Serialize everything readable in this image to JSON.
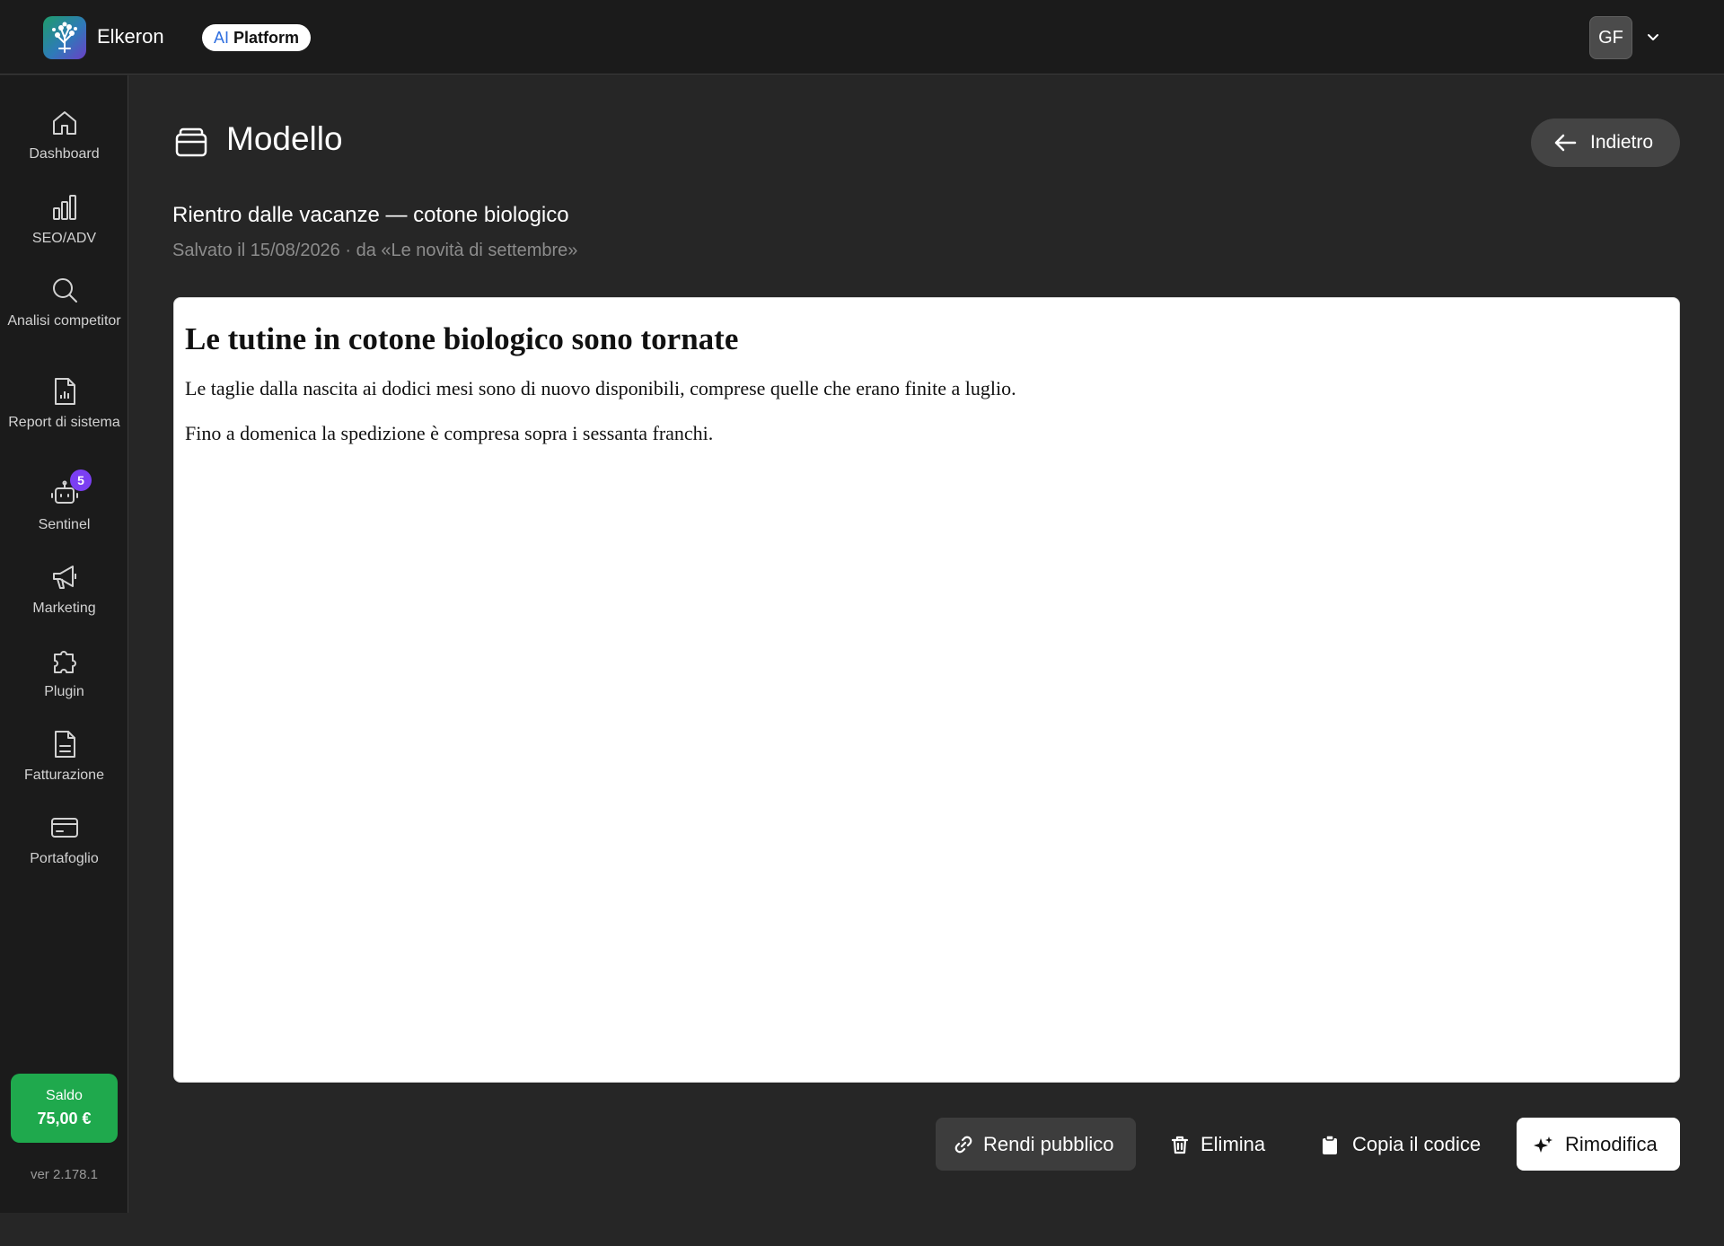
{
  "header": {
    "brand": "Elkeron",
    "badge_ai": "AI",
    "badge_rest": " Platform",
    "user_initials": "GF"
  },
  "sidebar": {
    "items": [
      {
        "label": "Dashboard",
        "icon": "home-icon"
      },
      {
        "label": "SEO/ADV",
        "icon": "bar-chart-icon"
      },
      {
        "label": "Analisi competitor",
        "icon": "search-icon"
      },
      {
        "label": "Report di sistema",
        "icon": "report-icon"
      },
      {
        "label": "Sentinel",
        "icon": "robot-icon",
        "badge": "5"
      },
      {
        "label": "Marketing",
        "icon": "megaphone-icon"
      },
      {
        "label": "Plugin",
        "icon": "puzzle-icon"
      },
      {
        "label": "Fatturazione",
        "icon": "invoice-icon"
      },
      {
        "label": "Portafoglio",
        "icon": "wallet-icon"
      }
    ],
    "saldo_label": "Saldo",
    "saldo_value": "75,00 €",
    "version": "ver 2.178.1"
  },
  "page": {
    "title": "Modello",
    "back_label": "Indietro",
    "subtitle": "Rientro dalle vacanze — cotone biologico",
    "meta": "Salvato il 15/08/2026 · da «Le novità di settembre»"
  },
  "preview": {
    "heading": "Le tutine in cotone biologico sono tornate",
    "paragraphs": [
      "Le taglie dalla nascita ai dodici mesi sono di nuovo disponibili, comprese quelle che erano finite a luglio.",
      "Fino a domenica la spedizione è compresa sopra i sessanta franchi."
    ]
  },
  "actions": {
    "make_public": "Rendi pubblico",
    "delete": "Elimina",
    "copy_code": "Copia il codice",
    "edit": "Rimodifica"
  },
  "colors": {
    "background": "#262626",
    "topbar": "#1b1b1b",
    "saldo": "#1fa94d",
    "badge": "#7b3ff2",
    "ai_accent": "#2f6fe0"
  }
}
